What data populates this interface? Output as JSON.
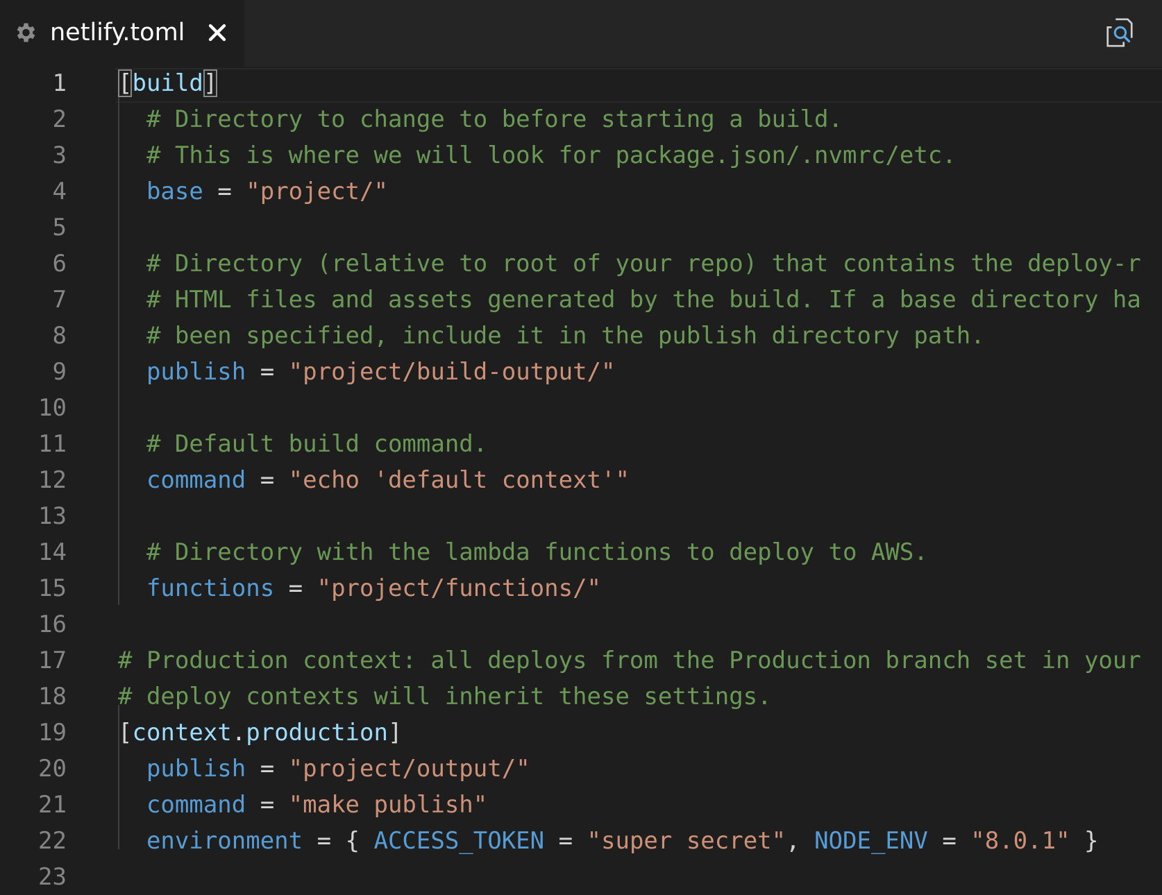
{
  "tab": {
    "title": "netlify.toml",
    "icon": "gear-icon",
    "close_icon": "close-icon"
  },
  "actions": {
    "find_icon": "search-icon"
  },
  "colors": {
    "comment": "#6a9955",
    "key": "#569cd6",
    "string": "#ce9178",
    "table": "#9cdcfe",
    "text": "#d4d4d4"
  },
  "lines": [
    {
      "n": "1",
      "indent": "",
      "tokens": [
        {
          "t": "[",
          "k": "op",
          "b": true
        },
        {
          "t": "build",
          "k": "table"
        },
        {
          "t": "]",
          "k": "op",
          "b": true
        }
      ]
    },
    {
      "n": "2",
      "indent": "  ",
      "tokens": [
        {
          "t": "# Directory to change to before starting a build.",
          "k": "comment"
        }
      ]
    },
    {
      "n": "3",
      "indent": "  ",
      "tokens": [
        {
          "t": "# This is where we will look for package.json/.nvmrc/etc.",
          "k": "comment"
        }
      ]
    },
    {
      "n": "4",
      "indent": "  ",
      "tokens": [
        {
          "t": "base",
          "k": "key"
        },
        {
          "t": " = ",
          "k": "op"
        },
        {
          "t": "\"project/\"",
          "k": "str"
        }
      ]
    },
    {
      "n": "5",
      "indent": "",
      "tokens": []
    },
    {
      "n": "6",
      "indent": "  ",
      "tokens": [
        {
          "t": "# Directory (relative to root of your repo) that contains the deploy-r",
          "k": "comment"
        }
      ]
    },
    {
      "n": "7",
      "indent": "  ",
      "tokens": [
        {
          "t": "# HTML files and assets generated by the build. If a base directory ha",
          "k": "comment"
        }
      ]
    },
    {
      "n": "8",
      "indent": "  ",
      "tokens": [
        {
          "t": "# been specified, include it in the publish directory path.",
          "k": "comment"
        }
      ]
    },
    {
      "n": "9",
      "indent": "  ",
      "tokens": [
        {
          "t": "publish",
          "k": "key"
        },
        {
          "t": " = ",
          "k": "op"
        },
        {
          "t": "\"project/build-output/\"",
          "k": "str"
        }
      ]
    },
    {
      "n": "10",
      "indent": "",
      "tokens": []
    },
    {
      "n": "11",
      "indent": "  ",
      "tokens": [
        {
          "t": "# Default build command.",
          "k": "comment"
        }
      ]
    },
    {
      "n": "12",
      "indent": "  ",
      "tokens": [
        {
          "t": "command",
          "k": "key"
        },
        {
          "t": " = ",
          "k": "op"
        },
        {
          "t": "\"echo 'default context'\"",
          "k": "str"
        }
      ]
    },
    {
      "n": "13",
      "indent": "",
      "tokens": []
    },
    {
      "n": "14",
      "indent": "  ",
      "tokens": [
        {
          "t": "# Directory with the lambda functions to deploy to AWS.",
          "k": "comment"
        }
      ]
    },
    {
      "n": "15",
      "indent": "  ",
      "tokens": [
        {
          "t": "functions",
          "k": "key"
        },
        {
          "t": " = ",
          "k": "op"
        },
        {
          "t": "\"project/functions/\"",
          "k": "str"
        }
      ]
    },
    {
      "n": "16",
      "indent": "",
      "tokens": []
    },
    {
      "n": "17",
      "indent": "",
      "tokens": [
        {
          "t": "# Production context: all deploys from the Production branch set in your",
          "k": "comment"
        }
      ]
    },
    {
      "n": "18",
      "indent": "",
      "tokens": [
        {
          "t": "# deploy contexts will inherit these settings.",
          "k": "comment"
        }
      ]
    },
    {
      "n": "19",
      "indent": "",
      "tokens": [
        {
          "t": "[",
          "k": "op"
        },
        {
          "t": "context",
          "k": "table"
        },
        {
          "t": ".",
          "k": "op"
        },
        {
          "t": "production",
          "k": "table"
        },
        {
          "t": "]",
          "k": "op"
        }
      ]
    },
    {
      "n": "20",
      "indent": "  ",
      "tokens": [
        {
          "t": "publish",
          "k": "key"
        },
        {
          "t": " = ",
          "k": "op"
        },
        {
          "t": "\"project/output/\"",
          "k": "str"
        }
      ]
    },
    {
      "n": "21",
      "indent": "  ",
      "tokens": [
        {
          "t": "command",
          "k": "key"
        },
        {
          "t": " = ",
          "k": "op"
        },
        {
          "t": "\"make publish\"",
          "k": "str"
        }
      ]
    },
    {
      "n": "22",
      "indent": "  ",
      "tokens": [
        {
          "t": "environment",
          "k": "key"
        },
        {
          "t": " = { ",
          "k": "op"
        },
        {
          "t": "ACCESS_TOKEN",
          "k": "key"
        },
        {
          "t": " = ",
          "k": "op"
        },
        {
          "t": "\"super secret\"",
          "k": "str"
        },
        {
          "t": ", ",
          "k": "op"
        },
        {
          "t": "NODE_ENV",
          "k": "key"
        },
        {
          "t": " = ",
          "k": "op"
        },
        {
          "t": "\"8.0.1\"",
          "k": "str"
        },
        {
          "t": " }",
          "k": "op"
        }
      ]
    },
    {
      "n": "23",
      "indent": "",
      "tokens": []
    }
  ]
}
